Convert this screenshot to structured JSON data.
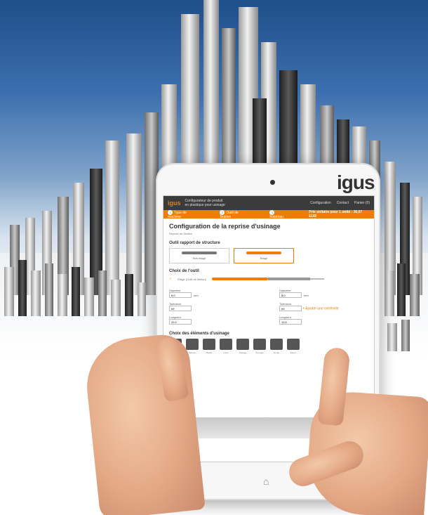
{
  "tablet": {
    "brand_logo": "igus"
  },
  "app": {
    "logo": "igus",
    "subtitle_line1": "Configurateur de produit",
    "subtitle_line2": "en plastique pour usinage",
    "top_links": [
      "Configuration",
      "Contact",
      "Panier (0)"
    ],
    "steps": [
      {
        "num": "1",
        "label": "Type de machine"
      },
      {
        "num": "2",
        "label": "Outil de fixation"
      },
      {
        "num": "3",
        "label": "Matériau"
      }
    ],
    "price_label": "Prix unitaire pour 1 unité : 36,97 EUR"
  },
  "page": {
    "title": "Configuration de la reprise d'usinage",
    "subtitle": "Reprise de fixation"
  },
  "sections": {
    "tool_structure": "Outil rapport de structure",
    "choices": [
      "Non étagé",
      "Étagé"
    ],
    "tool_choice": "Choix de l'outil",
    "tool_option": "Étagé (Outil de finition)",
    "add_button": "Ajouter une extrémité",
    "elements": "Choix des éléments d'usinage"
  },
  "form": {
    "left_label": "Diamètre",
    "left_value": "6,0",
    "left_unit": "mm",
    "left_tolerance_label": "Tolérance",
    "left_tolerance": "h9",
    "left_length_label": "Longueur",
    "left_length": "22,0",
    "right_label": "Diamètre",
    "right_value": "8,0",
    "right_unit": "mm",
    "right_tolerance_label": "Tolérance",
    "right_tolerance": "h9",
    "right_length_label": "Longueur",
    "right_length": "13,0"
  },
  "element_icons": [
    "Chanfrein",
    "Rainure",
    "Méplat",
    "Cône",
    "Filetage",
    "Perçage",
    "Gorge",
    "Rayon"
  ],
  "nav": {
    "back": "«",
    "home": "⌂",
    "menu": "▭"
  }
}
